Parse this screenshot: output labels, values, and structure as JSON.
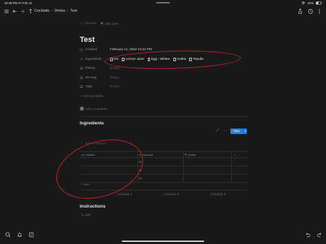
{
  "status_bar": {
    "time": "10:38 PM",
    "day": "Fri Feb 11",
    "battery": "42%"
  },
  "toolbar": {
    "breadcrumb": [
      "Cocktails",
      "Drinks",
      "Test"
    ]
  },
  "page": {
    "add_icon": "Add icon",
    "add_cover": "Add cover",
    "title": "Test",
    "properties": [
      {
        "icon": "clock-icon",
        "name": "Created",
        "value": "February 11, 2022 10:31 PM"
      },
      {
        "icon": "relation-icon",
        "name": "Ingredients",
        "chips": [
          "Gin",
          "Lemon Juice",
          "Egg - Whites",
          "Vodka",
          "Tequila"
        ]
      },
      {
        "icon": "list-icon",
        "name": "Rating",
        "value": "Empty"
      },
      {
        "icon": "list-icon",
        "name": "Serving",
        "value": "Empty"
      },
      {
        "icon": "list-icon",
        "name": "Tags",
        "value": "Empty"
      }
    ],
    "add_property": "Add a property",
    "add_comment": "Add a comment..."
  },
  "ingredients": {
    "heading": "Ingredients",
    "new_label": "New",
    "filter_placeholder": "Type to search...",
    "columns": [
      "Name",
      "Amount",
      "Units"
    ],
    "row_values": [
      "50",
      "50",
      "50"
    ],
    "new_row": "New",
    "calculate": "Calculate"
  },
  "instructions": {
    "heading": "Instructions",
    "list": "List"
  },
  "colors": {
    "accent": "#2383e2",
    "annotation": "#c8202a",
    "background": "#191919"
  }
}
